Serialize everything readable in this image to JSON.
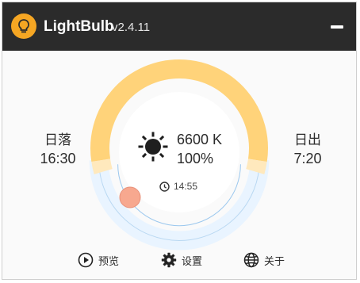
{
  "app": {
    "name": "LightBulb",
    "version": "v2.4.11"
  },
  "sunset": {
    "label": "日落",
    "time": "16:30"
  },
  "sunrise": {
    "label": "日出",
    "time": "7:20"
  },
  "status": {
    "temperature": "6600 K",
    "brightness": "100%",
    "current_time": "14:55"
  },
  "footer": {
    "preview_label": "预览",
    "settings_label": "设置",
    "about_label": "关于"
  },
  "colors": {
    "day": "#ffd37a",
    "night": "#e9f4ff",
    "transition": "#ffe9bd",
    "indicator": "#f7a88f",
    "titlebar": "#2b2b2b",
    "accent": "#f5a623"
  },
  "icons": {
    "logo": "lightbulb-icon",
    "sun": "sun-icon",
    "clock": "clock-icon",
    "preview": "play-circle-icon",
    "settings": "gear-icon",
    "about": "globe-icon",
    "window": "minimize-icon"
  }
}
